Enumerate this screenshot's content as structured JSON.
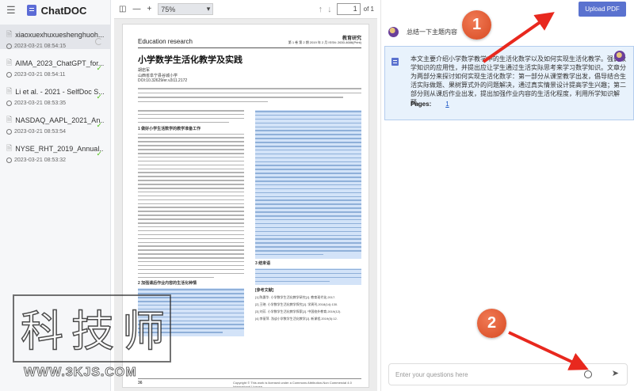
{
  "app": {
    "title": "ChatDOC",
    "menu_icon": "menu-fold-icon",
    "logo_icon": "chatdoc-logo-icon"
  },
  "files": [
    {
      "name": "xiaoxuexhuxueshenghuoh...",
      "date": "2023-03-21 08:54:15",
      "status": "loading"
    },
    {
      "name": "AIMA_2023_ChatGPT_for...",
      "date": "2023-03-21 08:54:11",
      "status": "done"
    },
    {
      "name": "Li et al. - 2021 - SelfDoc S...",
      "date": "2023-03-21 08:53:35",
      "status": "done"
    },
    {
      "name": "NASDAQ_AAPL_2021_An...",
      "date": "2023-03-21 08:53:54",
      "status": "done"
    },
    {
      "name": "NYSE_RHT_2019_Annual...",
      "date": "2023-03-21 08:53:32",
      "status": "done"
    }
  ],
  "viewer": {
    "zoom": "75%",
    "page": "1",
    "of_label": "of 1",
    "document": {
      "section_label": "Education research",
      "journal": "教育研究",
      "journal_meta": "第 1 卷 第 2 期 2019 年 2 月  ISSN: 2630-4686(Print)",
      "title": "小学数学生活化教学及实践",
      "author": "胡岩军",
      "affiliation": "山西省阜宁县谷城小学",
      "doi": "DOI:10.32629/er.v2i11.2172",
      "section_heading_1": "1 做好小学生活数学的教学准备工作",
      "section_heading_2": "2 加强课后作业内容的生活化种情",
      "section_heading_3": "3 结束语",
      "ref_heading": "[参考文献]",
      "refs": [
        "[1] 陈惠华. 小学数学生活化教学研究[J]. 教育现代化,2017.",
        "[2] 王晓. 小学数学生活化教学探究[J]. 学周刊,2018(14):130.",
        "[3] 刘芳. 小学数学生活化教学探索[J]. 中国校外教育,2019(12).",
        "[4] 李丽萍. 浅谈小学数学生活化教学[J]. 新课程,2019(5):12."
      ],
      "page_number": "36",
      "copyright": "Copyright © This work is licensed under a Commons Attribution-Non Commercial 4.0 International License."
    }
  },
  "chat": {
    "upload_label": "Upload PDF",
    "user_message": "总结一下主题内容",
    "bot_reply": "本文主要介绍小学数学教学中的生活化数学以及如何实现生活化教学。强调数学知识的应用性，并提出应让学生通过生活实际思考来学习数学知识。文章分为两部分来探讨如何实现生活化数学：第一部分从课堂教学出发，倡导结合生活实际做题、果树算式外的问题解决，通过真实情景设计提高学生兴趣；第二部分则从课后作业出发，提出加强作业内容的生活化程度，利用所学知识解释。",
    "pages_label": "Pages:",
    "pages_link": "1",
    "input_placeholder": "Enter your questions here"
  },
  "annotations": {
    "badge_1": "1",
    "badge_2": "2",
    "arrow_color": "#e8281e",
    "badge_color": "#e25a33"
  },
  "watermark": {
    "text": "科技师",
    "url": "WWW.3KJS.COM"
  },
  "colors": {
    "accent": "#5a72cf",
    "highlight": "#d3e3f8",
    "reply_bg": "#e8f2fc",
    "success": "#52c41a"
  }
}
